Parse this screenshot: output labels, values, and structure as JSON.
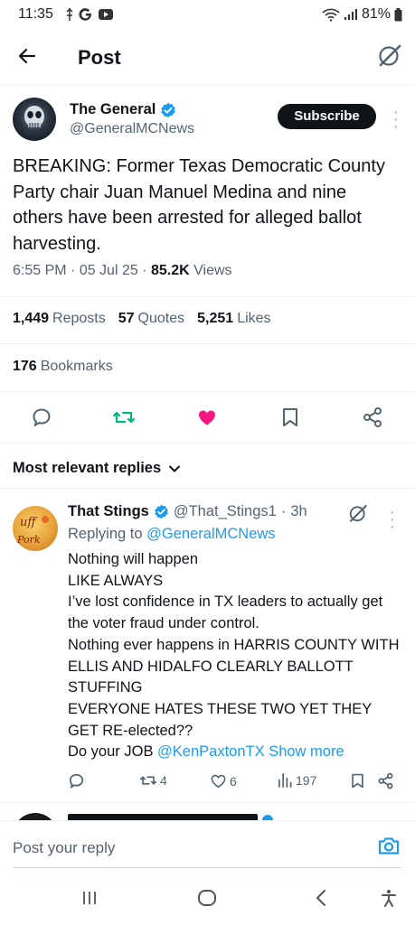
{
  "status_bar": {
    "time": "11:35",
    "battery": "81%"
  },
  "header": {
    "title": "Post"
  },
  "post": {
    "author_name": "The General",
    "author_handle": "@GeneralMCNews",
    "subscribe_label": "Subscribe",
    "text": "BREAKING: Former Texas Democratic County Party chair Juan Manuel Medina and nine others have been arrested for alleged ballot harvesting.",
    "time": "6:55 PM",
    "date": "05 Jul 25",
    "views_count": "85.2K",
    "views_label": "Views",
    "reposts_count": "1,449",
    "reposts_label": "Reposts",
    "quotes_count": "57",
    "quotes_label": "Quotes",
    "likes_count": "5,251",
    "likes_label": "Likes",
    "bookmarks_count": "176",
    "bookmarks_label": "Bookmarks",
    "liked": true
  },
  "replies_sort": "Most relevant replies",
  "reply": {
    "name": "That Stings",
    "handle": "@That_Stings1",
    "time": "3h",
    "replying_to_prefix": "Replying to",
    "replying_to_handle": "@GeneralMCNews",
    "lines": [
      "Nothing will happen",
      "LIKE ALWAYS",
      "I’ve lost confidence in TX leaders to actually get the voter fraud under control.",
      "Nothing ever happens in HARRIS COUNTY WITH ELLIS AND HIDALFO CLEARLY BALLOTT STUFFING",
      "EVERYONE HATES THESE TWO YET THEY GET RE-elected??",
      "Do your JOB"
    ],
    "mention": "@KenPaxtonTX",
    "show_more": "Show more",
    "reposts": "4",
    "likes": "6",
    "views": "197"
  },
  "compose": {
    "placeholder": "Post your reply"
  },
  "colors": {
    "accent": "#1d9bf0",
    "like": "#f91880",
    "repost": "#00ba7c",
    "text": "#0f1419",
    "muted": "#536471"
  },
  "icons": [
    "back-arrow-icon",
    "grok-icon",
    "verified-badge-icon",
    "reply-icon",
    "repost-icon",
    "heart-icon",
    "bookmark-icon",
    "share-icon",
    "camera-icon",
    "views-icon"
  ]
}
